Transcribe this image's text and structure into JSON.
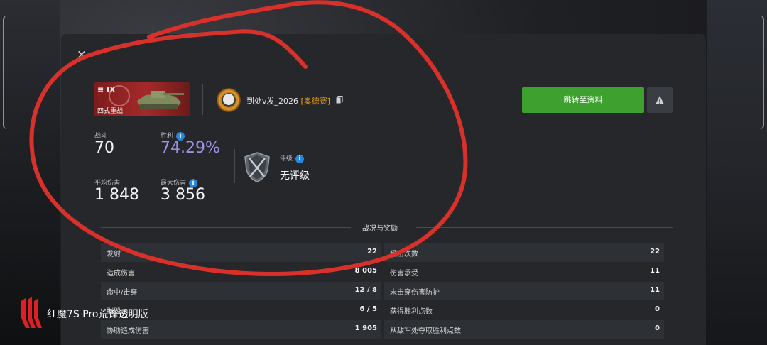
{
  "dialog": {
    "close_label": "×",
    "tank": {
      "tier": "≡ IX",
      "name": "四式重战"
    },
    "player": {
      "name": "到处v发_2026",
      "clan": "[奥德赛]"
    },
    "stats": {
      "battles_label": "战斗",
      "battles_value": "70",
      "winrate_label": "胜利",
      "winrate_value": "74.29%",
      "avg_damage_label": "平均伤害",
      "avg_damage_value": "1 848",
      "max_damage_label": "最大伤害",
      "max_damage_value": "3 856"
    },
    "rating": {
      "label": "评级",
      "value": "无评级"
    },
    "buttons": {
      "goto_profile": "跳转至资料",
      "info_glyph": "i"
    },
    "section_title": "战况与奖励",
    "left_rows": [
      {
        "label": "发射",
        "value": "22"
      },
      {
        "label": "造成伤害",
        "value": "8 005"
      },
      {
        "label": "命中/击穿",
        "value": "12 / 8"
      },
      {
        "label": "摧毁",
        "value": "6 / 5"
      },
      {
        "label": "协助造成伤害",
        "value": "1 905"
      }
    ],
    "right_rows": [
      {
        "label": "受击次数",
        "value": "22"
      },
      {
        "label": "伤害承受",
        "value": "11"
      },
      {
        "label": "未击穿伤害防护",
        "value": "11"
      },
      {
        "label": "获得胜利点数",
        "value": "0"
      },
      {
        "label": "从敌军处夺取胜利点数",
        "value": "0"
      }
    ]
  },
  "watermark": {
    "text": "红魔7S Pro荒锋透明版"
  },
  "colors": {
    "accent_green": "#3ea02e",
    "winrate_purple": "#a08ee6",
    "clan_orange": "#e8a020",
    "info_blue": "#2a86d8",
    "scribble_red": "#d8302a"
  }
}
